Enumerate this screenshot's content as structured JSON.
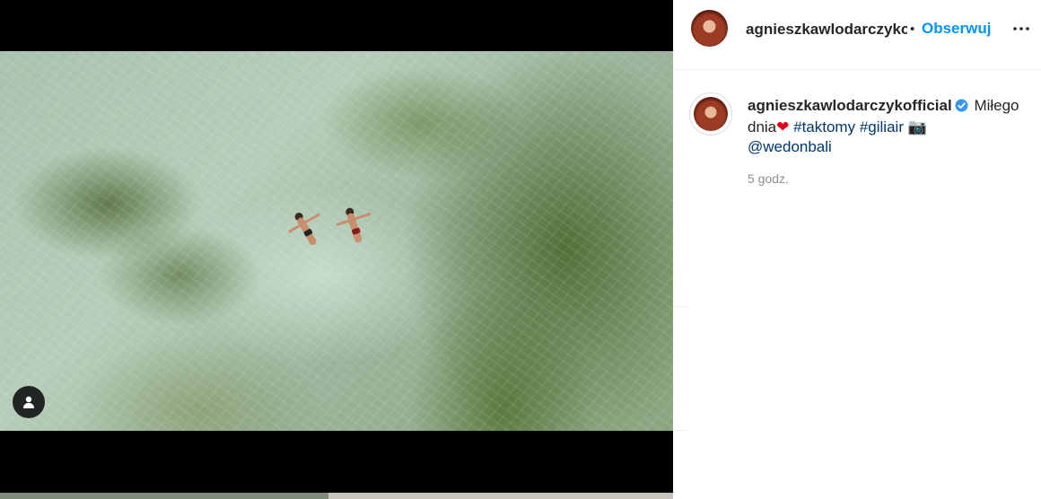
{
  "post": {
    "username": "agnieszkawlodarczykofficial",
    "follow_label": "Obserwuj",
    "separator": "•",
    "caption": {
      "username": "agnieszkawlodarczykofficial",
      "text_before": "Miłego dnia",
      "emoji_heart": "❤",
      "hashtags": [
        "#taktomy",
        "#giliair"
      ],
      "emoji_camera": "📷",
      "mention": "@wedonbali"
    },
    "timestamp": "5 godz."
  },
  "colors": {
    "follow_blue": "#0095f6",
    "link_navy": "#00376b",
    "verified_blue": "#3897f0",
    "muted": "#8e8e8e"
  },
  "icons": {
    "more": "more-options-icon",
    "verified": "verified-badge-icon",
    "tag": "user-tag-icon"
  }
}
